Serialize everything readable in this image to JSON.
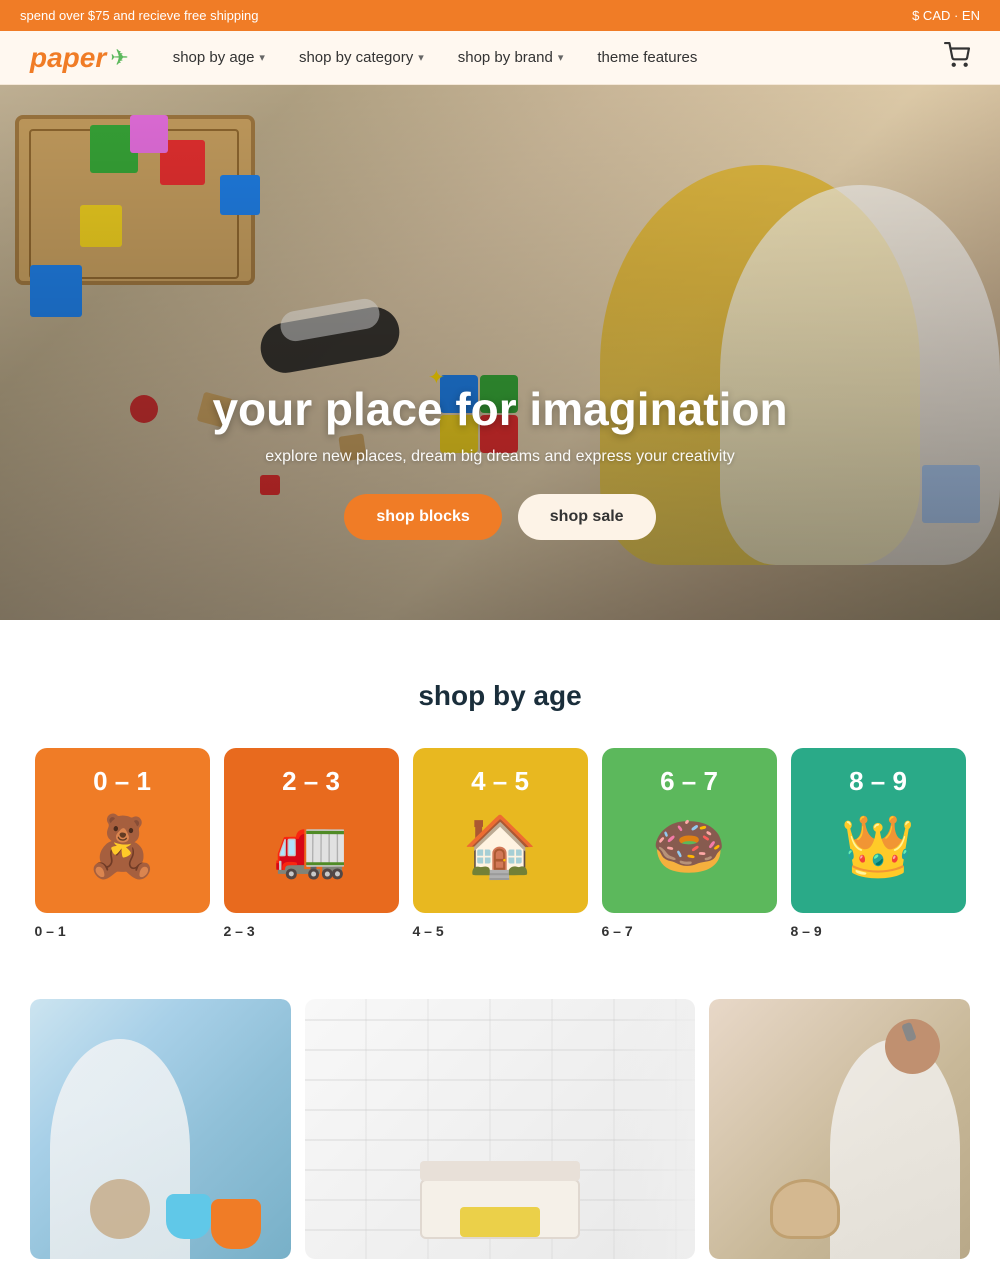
{
  "announcement": {
    "text": "spend over $75 and recieve free shipping",
    "currency": "$ CAD · EN"
  },
  "header": {
    "logo": "paper",
    "nav": [
      {
        "id": "shop-by-age",
        "label": "shop by age",
        "has_dropdown": true
      },
      {
        "id": "shop-by-category",
        "label": "shop by category",
        "has_dropdown": true
      },
      {
        "id": "shop-by-brand",
        "label": "shop by brand",
        "has_dropdown": true
      },
      {
        "id": "theme-features",
        "label": "theme features",
        "has_dropdown": false
      }
    ]
  },
  "hero": {
    "title": "your place for imagination",
    "subtitle": "explore new places, dream big dreams and express your creativity",
    "btn_primary": "shop blocks",
    "btn_secondary": "shop sale"
  },
  "shop_age": {
    "section_title": "shop by age",
    "cards": [
      {
        "id": "0-1",
        "label_top": "0 – 1",
        "label_bottom": "0 – 1",
        "emoji": "🧸",
        "color_class": "age-0-1"
      },
      {
        "id": "2-3",
        "label_top": "2 – 3",
        "label_bottom": "2 – 3",
        "emoji": "🚛",
        "color_class": "age-2-3"
      },
      {
        "id": "4-5",
        "label_top": "4 – 5",
        "label_bottom": "4 – 5",
        "emoji": "🏠",
        "color_class": "age-4-5"
      },
      {
        "id": "6-7",
        "label_top": "6 – 7",
        "label_bottom": "6 – 7",
        "emoji": "🍩",
        "color_class": "age-6-7"
      },
      {
        "id": "8-9",
        "label_top": "8 – 9",
        "label_bottom": "8 – 9",
        "emoji": "👑",
        "color_class": "age-8-9"
      }
    ]
  }
}
